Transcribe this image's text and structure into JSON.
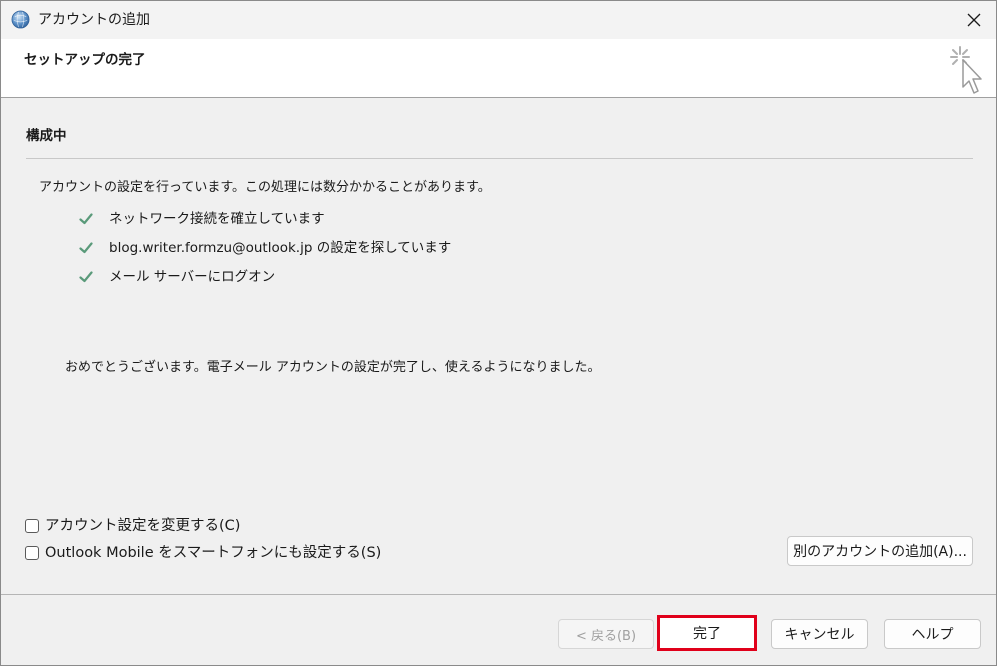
{
  "window": {
    "title": "アカウントの追加",
    "icons": {
      "app": "outlook-globe-icon",
      "close": "close-icon",
      "wizard": "cursor-sparkle-icon"
    }
  },
  "header": {
    "title": "セットアップの完了"
  },
  "section": {
    "title": "構成中",
    "intro": "アカウントの設定を行っています。この処理には数分かかることがあります。"
  },
  "steps": [
    {
      "label": "ネットワーク接続を確立しています",
      "status": "done",
      "icon": "check-icon"
    },
    {
      "label": "blog.writer.formzu@outlook.jp の設定を探しています",
      "status": "done",
      "icon": "check-icon"
    },
    {
      "label": "メール サーバーにログオン",
      "status": "done",
      "icon": "check-icon"
    }
  ],
  "success_message": "おめでとうございます。電子メール アカウントの設定が完了し、使えるようになりました。",
  "options": {
    "change_settings": {
      "label": "アカウント設定を変更する(C)",
      "checked": false
    },
    "outlook_mobile": {
      "label": "Outlook Mobile をスマートフォンにも設定する(S)",
      "checked": false
    }
  },
  "buttons": {
    "add_another": "別のアカウントの追加(A)...",
    "back": "< 戻る(B)",
    "finish": "完了",
    "cancel": "キャンセル",
    "help": "ヘルプ"
  },
  "colors": {
    "check": "#5a9a7a",
    "highlight": "#e0001a"
  }
}
